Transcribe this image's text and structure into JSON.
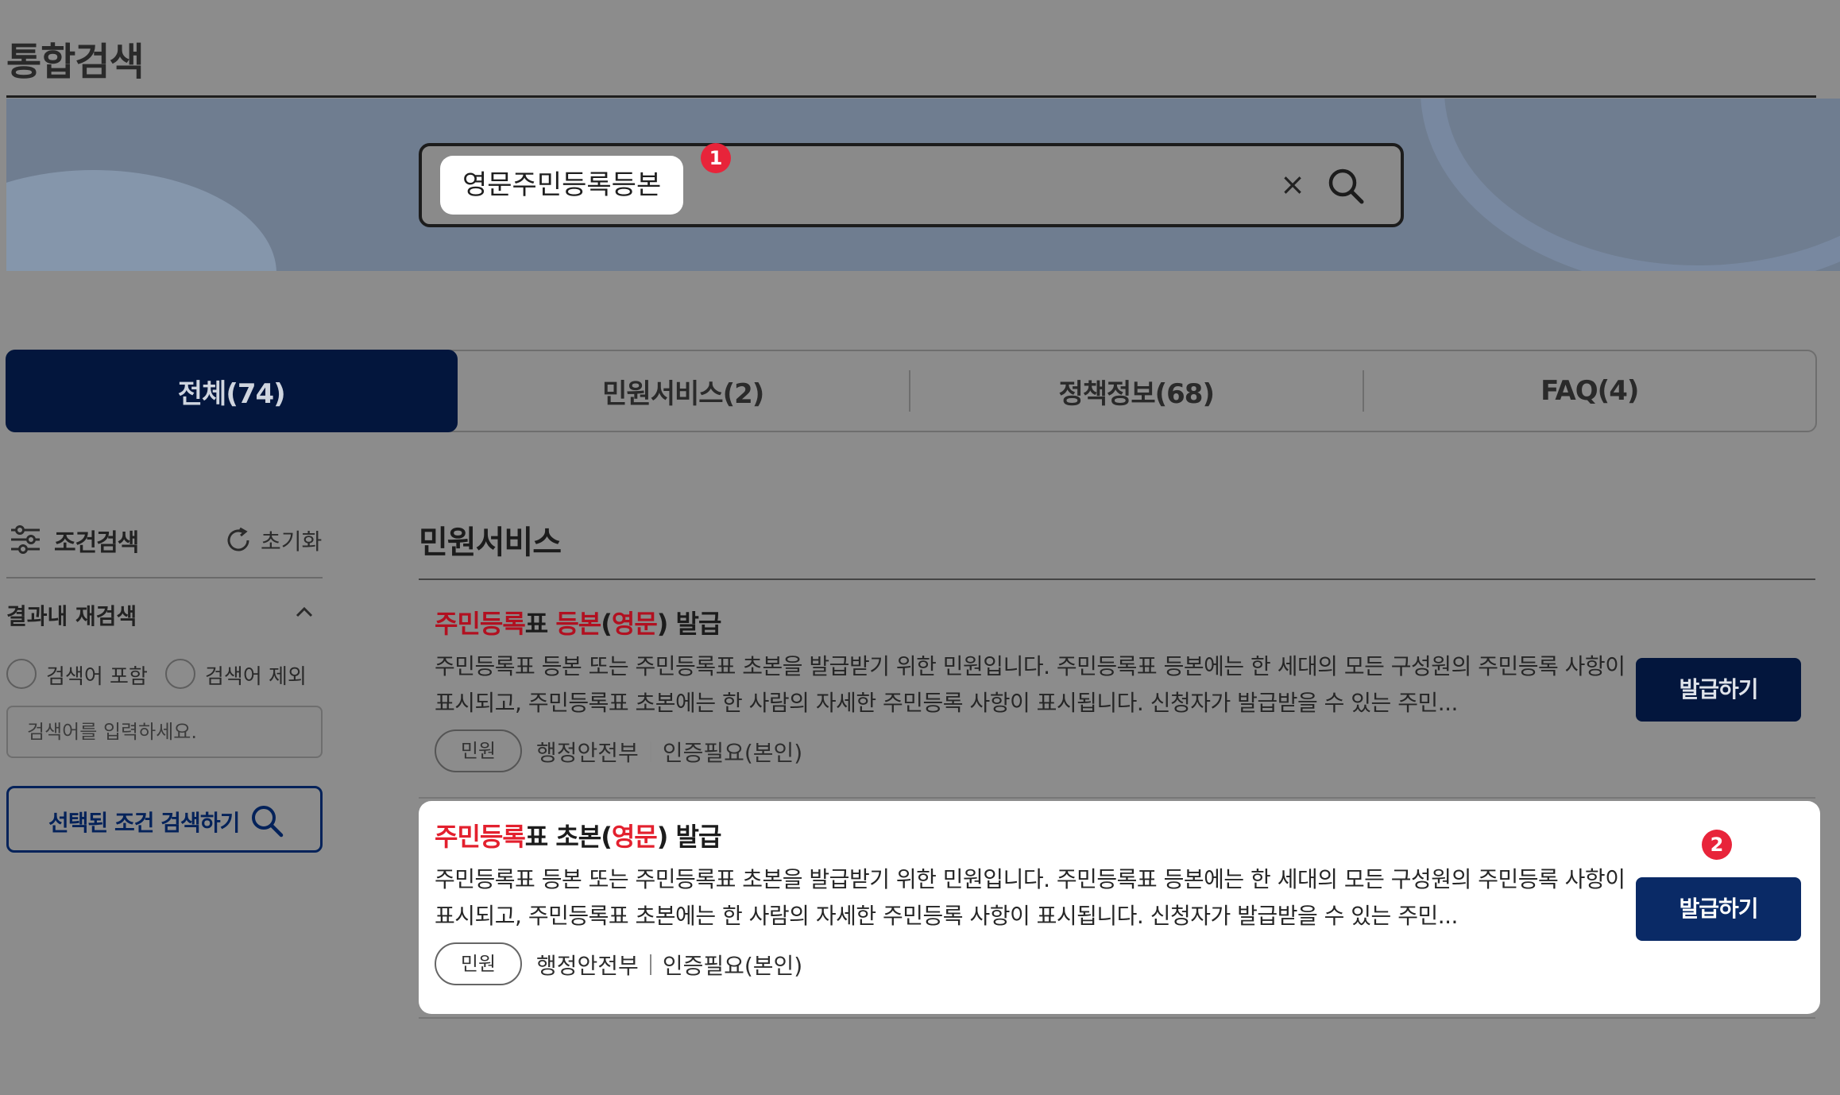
{
  "page": {
    "title": "통합검색"
  },
  "search": {
    "query": "영문주민등록등본",
    "clear_symbol": "×",
    "step_badge": "1"
  },
  "tabs": [
    {
      "label": "전체(74)",
      "active": true
    },
    {
      "label": "민원서비스(2)",
      "active": false
    },
    {
      "label": "정책정보(68)",
      "active": false
    },
    {
      "label": "FAQ(4)",
      "active": false
    }
  ],
  "filter": {
    "title": "조건검색",
    "reset_label": "초기화",
    "refine_label": "결과내 재검색",
    "include_label": "검색어 포함",
    "exclude_label": "검색어 제외",
    "input_placeholder": "검색어를 입력하세요.",
    "submit_label": "선택된 조건 검색하기"
  },
  "section": {
    "title": "민원서비스"
  },
  "results": [
    {
      "title_parts": [
        "주민등록",
        "표 ",
        "등본",
        "(",
        "영문",
        ") 발급"
      ],
      "description": "주민등록표 등본 또는 주민등록표 초본을 발급받기 위한 민원입니다. 주민등록표 등본에는 한 세대의 모든 구성원의 주민등록 사항이 표시되고, 주민등록표 초본에는 한 사람의 자세한 주민등록 사항이 표시됩니다. 신청자가 발급받을 수 있는 주민...",
      "tag": "민원",
      "department": "행정안전부",
      "auth": "인증필요(본인)",
      "button_label": "발급하기"
    },
    {
      "title_parts": [
        "주민등록",
        "표 초본(",
        "영문",
        ") 발급"
      ],
      "description": "주민등록표 등본 또는 주민등록표 초본을 발급받기 위한 민원입니다. 주민등록표 등본에는 한 세대의 모든 구성원의 주민등록 사항이 표시되고, 주민등록표 초본에는 한 사람의 자세한 주민등록 사항이 표시됩니다. 신청자가 발급받을 수 있는 주민...",
      "tag": "민원",
      "department": "행정안전부",
      "auth": "인증필요(본인)",
      "button_label": "발급하기",
      "step_badge": "2"
    }
  ],
  "colors": {
    "overlay": "#8c8c8c",
    "navy": "#03163d",
    "highlight_red": "#e3202e",
    "badge_red": "#e8243a"
  }
}
